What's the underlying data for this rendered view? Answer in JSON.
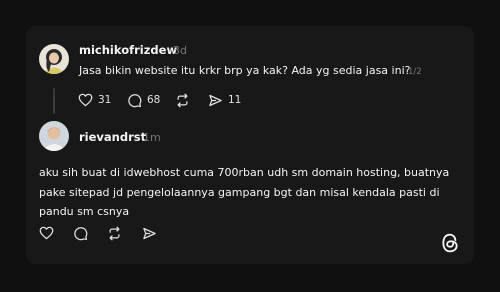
{
  "post": {
    "username": "michikofrizdew",
    "time": "3d",
    "text": "Jasa bikin website itu krkr brp ya kak? Ada yg sedia jasa ini?",
    "page_indicator": "1/2",
    "likes": "31",
    "comments": "68",
    "shares": "11",
    "icons": [
      "heart-icon",
      "comment-icon",
      "repost-icon",
      "share-icon"
    ]
  },
  "reply": {
    "username": "rievandrst",
    "time": "1m",
    "text": "aku sih buat di idwebhost cuma 700rban udh sm domain hosting, buatnya pake sitepad jd pengelolaannya gampang bgt dan misal kendala pasti di pandu sm csnya",
    "icons": [
      "heart-icon",
      "comment-icon",
      "repost-icon",
      "share-icon"
    ]
  },
  "brand": {
    "logo": "threads-logo-icon"
  },
  "colors": {
    "background": "#101010",
    "card": "#181818",
    "muted": "#777777",
    "text": "#f3f5f7"
  }
}
